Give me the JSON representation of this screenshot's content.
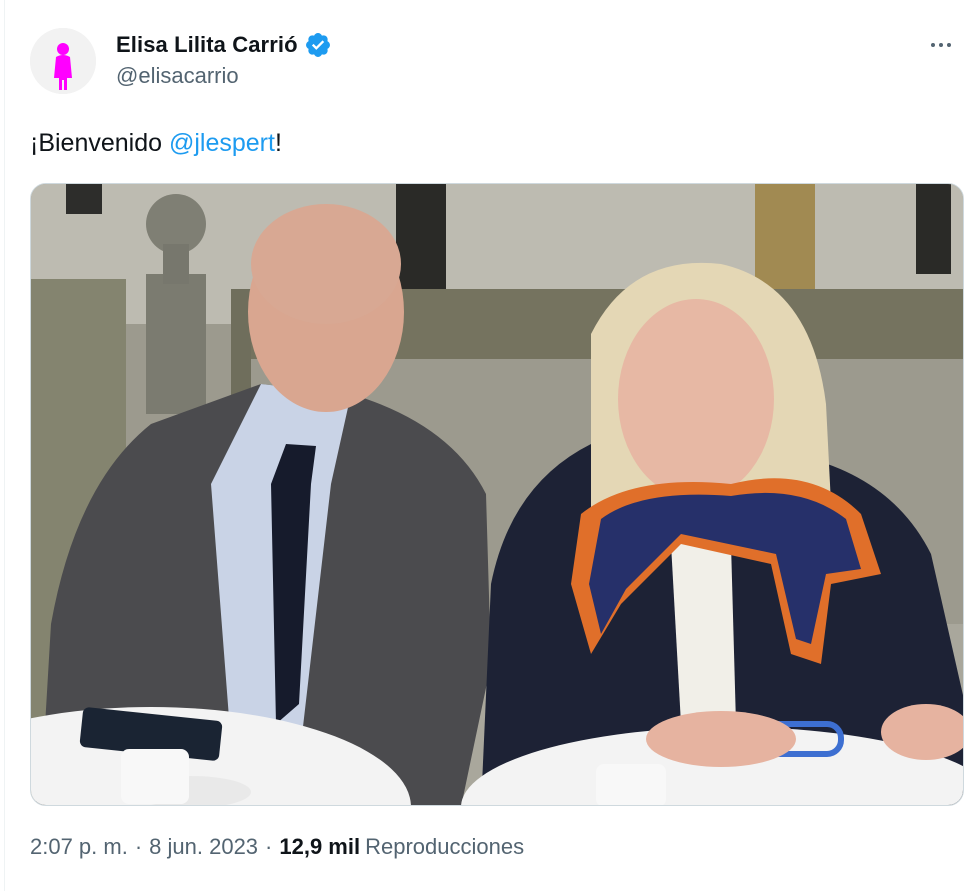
{
  "author": {
    "display_name": "Elisa Lilita Carrió",
    "handle": "@elisacarrio",
    "verified_icon": "verified-badge-icon",
    "avatar_icon": "woman-silhouette-icon",
    "avatar_color": "#ff00ff"
  },
  "menu": {
    "icon": "more-horizontal-icon"
  },
  "tweet": {
    "text_before": "¡Bienvenido ",
    "mention": "@jlespert",
    "text_after": "!"
  },
  "meta": {
    "time": "2:07 p. m.",
    "separator": "·",
    "date": "8 jun. 2023",
    "views_count": "12,9 mil",
    "views_label": "Reproducciones"
  },
  "colors": {
    "link": "#1d9bf0",
    "secondary_text": "#536471",
    "primary_text": "#0f1419",
    "verified": "#1d9bf0"
  }
}
